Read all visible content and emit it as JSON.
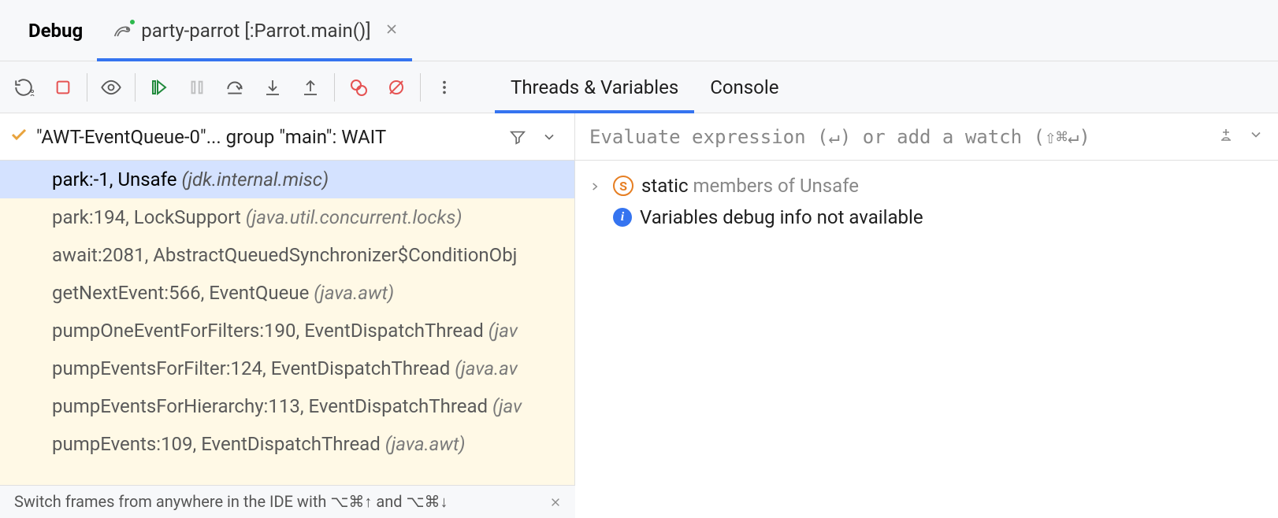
{
  "header": {
    "title": "Debug",
    "run_config": "party-parrot [:Parrot.main()]"
  },
  "content_tabs": {
    "threads": "Threads & Variables",
    "console": "Console"
  },
  "thread_header": "\"AWT-EventQueue-0\"... group \"main\": WAIT",
  "frames": [
    {
      "method": "park:-1, Unsafe ",
      "pkg": "(jdk.internal.misc)"
    },
    {
      "method": "park:194, LockSupport ",
      "pkg": "(java.util.concurrent.locks)"
    },
    {
      "method": "await:2081, AbstractQueuedSynchronizer$ConditionObj",
      "pkg": ""
    },
    {
      "method": "getNextEvent:566, EventQueue ",
      "pkg": "(java.awt)"
    },
    {
      "method": "pumpOneEventForFilters:190, EventDispatchThread ",
      "pkg": "(jav"
    },
    {
      "method": "pumpEventsForFilter:124, EventDispatchThread ",
      "pkg": "(java.av"
    },
    {
      "method": "pumpEventsForHierarchy:113, EventDispatchThread ",
      "pkg": "(jav"
    },
    {
      "method": "pumpEvents:109, EventDispatchThread ",
      "pkg": "(java.awt)"
    }
  ],
  "watch_placeholder": "Evaluate expression (↵) or add a watch (⇧⌘↵)",
  "variables": {
    "static_label_prefix": "static",
    "static_label_suffix": " members of Unsafe",
    "info_msg": "Variables debug info not available"
  },
  "footer_tip": "Switch frames from anywhere in the IDE with ⌥⌘↑ and ⌥⌘↓"
}
